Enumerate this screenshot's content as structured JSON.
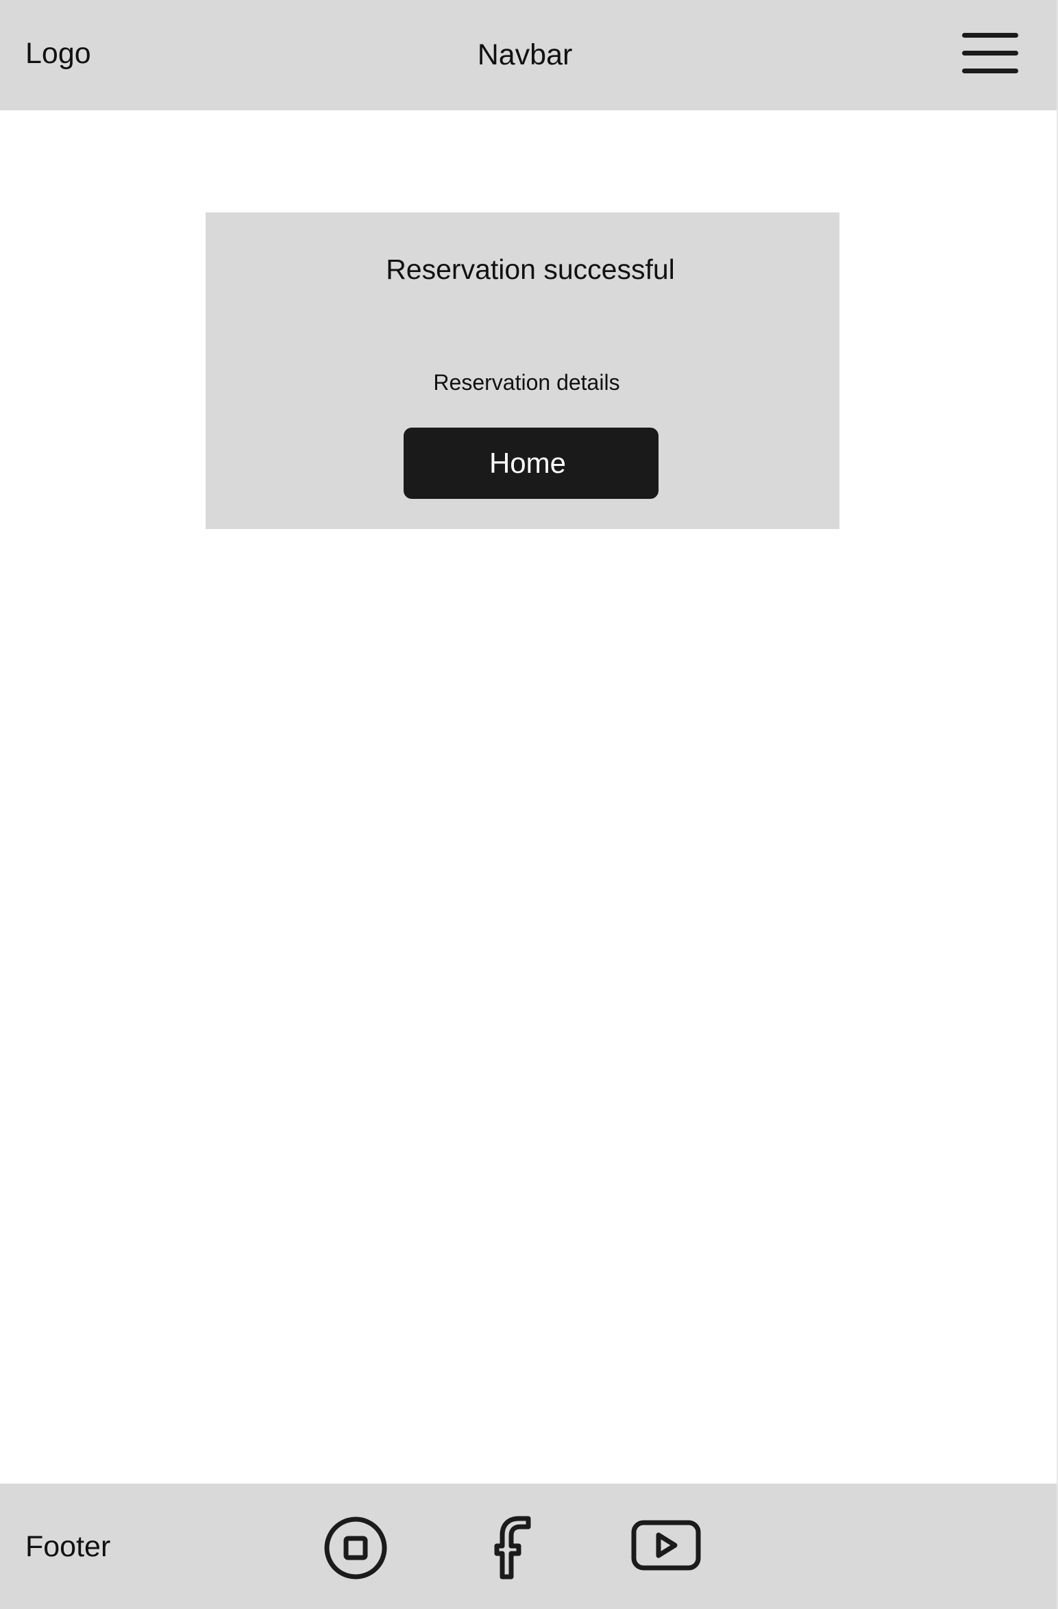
{
  "navbar": {
    "logo": "Logo",
    "title": "Navbar",
    "menu_icon": "hamburger-menu-icon"
  },
  "card": {
    "title": "Reservation successful",
    "details": "Reservation details",
    "home_button_label": "Home"
  },
  "footer": {
    "label": "Footer",
    "social_icons": [
      "instagram-icon",
      "facebook-icon",
      "youtube-icon"
    ]
  },
  "colors": {
    "bar_background": "#d9d9d9",
    "page_background": "#ffffff",
    "button_background": "#1a1a1a",
    "button_text": "#ffffff",
    "text": "#111111"
  }
}
